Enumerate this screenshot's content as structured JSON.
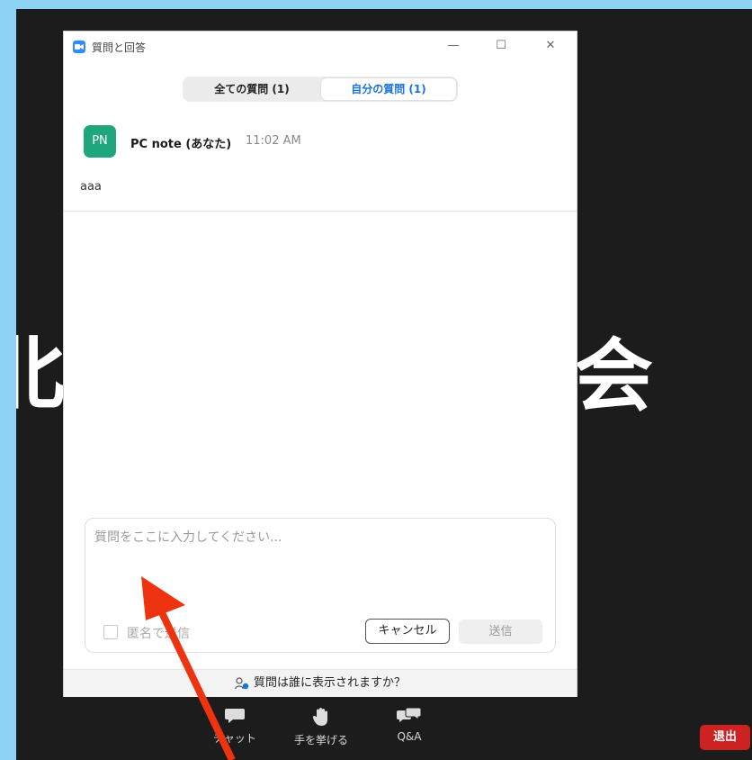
{
  "window": {
    "title": "質問と回答",
    "controls": {
      "minimize": "—",
      "maximize": "☐",
      "close": "✕"
    }
  },
  "tabs": [
    {
      "label": "全ての質問 (1)",
      "selected": false
    },
    {
      "label": "自分の質問 (1)",
      "selected": true
    }
  ],
  "question": {
    "avatar_initials": "PN",
    "author": "PC note (あなた)",
    "time": "11:02 AM",
    "text": "aaa"
  },
  "compose": {
    "placeholder": "質問をここに入力してください...",
    "value": "",
    "anonymous_label": "匿名で送信",
    "cancel_label": "キャンセル",
    "send_label": "送信"
  },
  "footer": {
    "visibility_link": "質問は誰に表示されますか？"
  },
  "toolbar": {
    "chat_label": "チャット",
    "raise_hand_label": "手を挙げる",
    "qa_label": "Q&A",
    "leave_label": "退出"
  },
  "background": {
    "left_text": "北",
    "right_text": "会"
  },
  "colors": {
    "accent_blue": "#1a73d9",
    "avatar_green": "#1fa67a",
    "leave_red": "#cc2222",
    "arrow_red": "#ee3311",
    "frame": "#8fd3f4"
  }
}
